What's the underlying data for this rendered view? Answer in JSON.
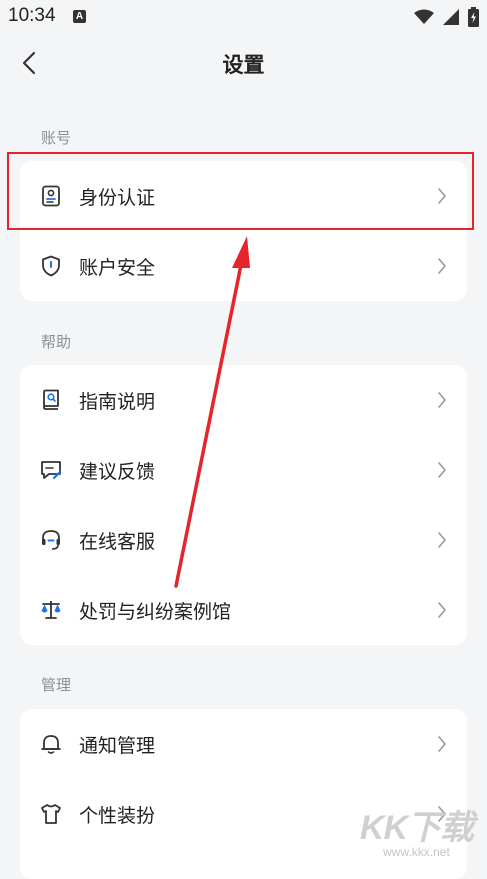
{
  "status_bar": {
    "time": "10:34",
    "notification_badge": "A"
  },
  "header": {
    "title": "设置"
  },
  "sections": {
    "account": {
      "label": "账号",
      "items": [
        {
          "label": "身份认证",
          "icon": "id-card-icon"
        },
        {
          "label": "账户安全",
          "icon": "shield-icon"
        }
      ]
    },
    "help": {
      "label": "帮助",
      "items": [
        {
          "label": "指南说明",
          "icon": "guide-book-icon"
        },
        {
          "label": "建议反馈",
          "icon": "feedback-icon"
        },
        {
          "label": "在线客服",
          "icon": "headset-icon"
        },
        {
          "label": "处罚与纠纷案例馆",
          "icon": "scale-icon"
        }
      ]
    },
    "manage": {
      "label": "管理",
      "items": [
        {
          "label": "通知管理",
          "icon": "bell-icon"
        },
        {
          "label": "个性装扮",
          "icon": "tshirt-icon"
        }
      ]
    }
  },
  "colors": {
    "highlight": "#e5242b",
    "accent": "#1a73e8",
    "background": "#f4f5f7"
  },
  "watermark": {
    "logo": "KK下载",
    "url": "www.kkx.net"
  }
}
